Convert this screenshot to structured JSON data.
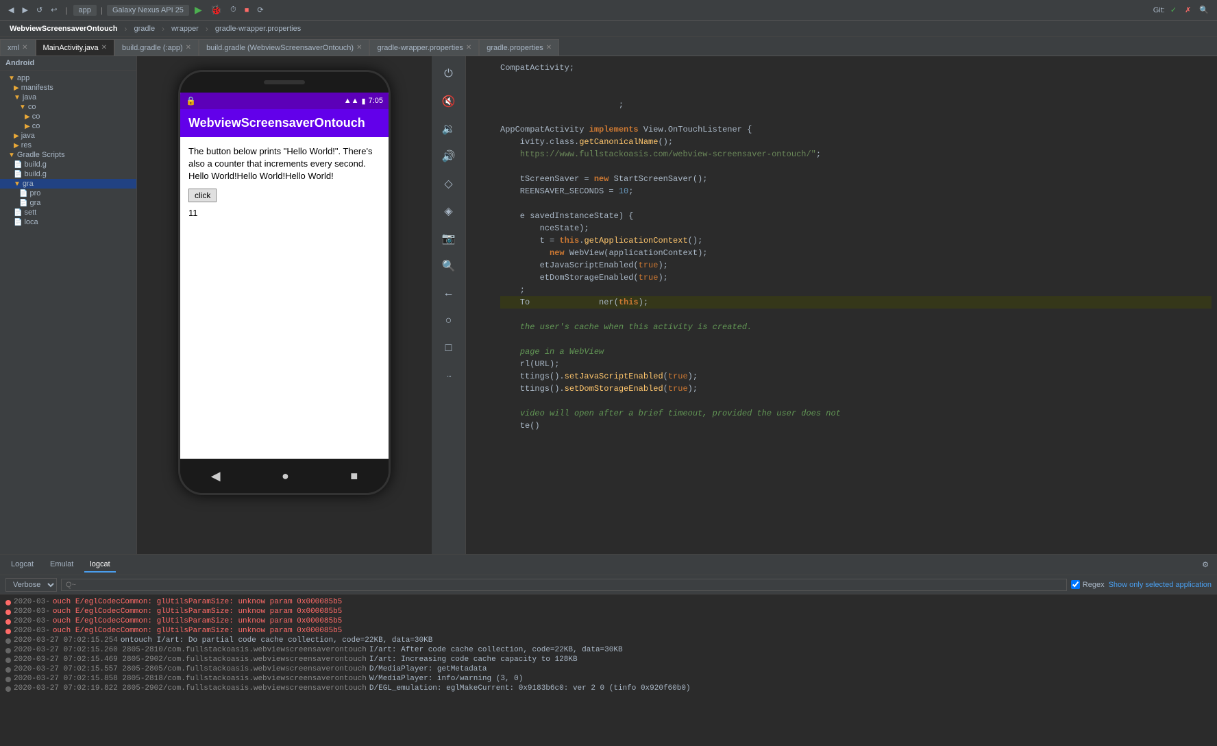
{
  "window": {
    "title": "WebviewScreensaverOntouch"
  },
  "top_toolbar": {
    "device_selector": "Galaxy Nexus API 25",
    "app_module": "app",
    "git_label": "Git:",
    "buttons": [
      "undo",
      "redo",
      "run",
      "debug",
      "profile",
      "stop",
      "sync"
    ]
  },
  "project_breadcrumb": {
    "items": [
      "WebviewScreensaverOntouch",
      "gradle",
      "wrapper",
      "gradle-wrapper.properties"
    ]
  },
  "file_tabs": [
    {
      "label": "xml",
      "active": false
    },
    {
      "label": "MainActivity.java",
      "active": true
    },
    {
      "label": "build.gradle (:app)",
      "active": false
    },
    {
      "label": "build.gradle (WebviewScreensaverOntouch)",
      "active": false
    },
    {
      "label": "gradle-wrapper.properties",
      "active": false
    },
    {
      "label": "gradle.properties",
      "active": false
    }
  ],
  "sidebar": {
    "title": "Android",
    "tree": [
      {
        "level": 0,
        "type": "folder",
        "label": "app",
        "expanded": true
      },
      {
        "level": 1,
        "type": "folder",
        "label": "manifests",
        "expanded": false
      },
      {
        "level": 1,
        "type": "folder",
        "label": "java",
        "expanded": true
      },
      {
        "level": 2,
        "type": "folder",
        "label": "co",
        "expanded": true
      },
      {
        "level": 3,
        "type": "folder",
        "label": "co",
        "expanded": false
      },
      {
        "level": 3,
        "type": "folder",
        "label": "co",
        "expanded": false
      },
      {
        "level": 1,
        "type": "folder",
        "label": "java",
        "expanded": false
      },
      {
        "level": 1,
        "type": "folder",
        "label": "res",
        "expanded": false
      },
      {
        "level": 0,
        "type": "folder",
        "label": "Gradle Scripts",
        "expanded": true
      },
      {
        "level": 1,
        "type": "file",
        "label": "build.g",
        "expanded": false
      },
      {
        "level": 1,
        "type": "file",
        "label": "build.g",
        "expanded": false
      },
      {
        "level": 1,
        "type": "folder",
        "label": "gra",
        "expanded": false,
        "selected": true
      },
      {
        "level": 2,
        "type": "file",
        "label": "pro",
        "expanded": false
      },
      {
        "level": 2,
        "type": "file",
        "label": "gra",
        "expanded": false
      },
      {
        "level": 1,
        "type": "file",
        "label": "sett",
        "expanded": false
      },
      {
        "level": 1,
        "type": "file",
        "label": "loca",
        "expanded": false
      }
    ]
  },
  "phone": {
    "time": "7:05",
    "title": "WebviewScreensaverOntouch",
    "content_text": "The button below prints \"Hello World!\". There's also a counter that increments every second.\nHello World!Hello World!Hello World!",
    "button_label": "click",
    "counter": "11"
  },
  "tool_panel": {
    "icons": [
      "power",
      "speaker-off",
      "speaker-low",
      "speaker-high",
      "diamond",
      "diamond2",
      "camera",
      "search",
      "back",
      "circle",
      "square",
      "more"
    ]
  },
  "code_editor": {
    "lines": [
      {
        "text": "CompatActivity;",
        "highlight": false
      },
      {
        "text": "",
        "highlight": false
      },
      {
        "text": "",
        "highlight": false
      },
      {
        "text": "                      ;",
        "highlight": false
      },
      {
        "text": "",
        "highlight": false
      },
      {
        "text": "AppCompatActivity implements View.OnTouchListener {",
        "highlight": false
      },
      {
        "text": "    ivity.class.getCanonicalName();",
        "highlight": false
      },
      {
        "text": "    https://www.fullstackoasis.com/webview-screensaver-ontouch/\";",
        "highlight": false
      },
      {
        "text": "",
        "highlight": false
      },
      {
        "text": "    tScreenSaver = new StartScreenSaver();",
        "highlight": false
      },
      {
        "text": "    REENSAVER_SECONDS = 10;",
        "highlight": false
      },
      {
        "text": "",
        "highlight": false
      },
      {
        "text": "    e savedInstanceState) {",
        "highlight": false
      },
      {
        "text": "        nceState);",
        "highlight": false
      },
      {
        "text": "        t = this.getApplicationContext();",
        "highlight": false
      },
      {
        "text": "        new WebView(applicationContext);",
        "highlight": false
      },
      {
        "text": "        etJavaScriptEnabled(true);",
        "highlight": false
      },
      {
        "text": "        etDomStorageEnabled(true);",
        "highlight": false
      },
      {
        "text": "    ;",
        "highlight": false
      },
      {
        "text": "    To              ner(this);",
        "highlight": true
      },
      {
        "text": "",
        "highlight": false
      },
      {
        "text": "    the user's cache when this activity is created.",
        "highlight": false
      },
      {
        "text": "",
        "highlight": false
      },
      {
        "text": "    page in a WebView",
        "highlight": false
      },
      {
        "text": "    rl(URL);",
        "highlight": false
      },
      {
        "text": "    ttings().setJavaScriptEnabled(true);",
        "highlight": false
      },
      {
        "text": "    ttings().setDomStorageEnabled(true);",
        "highlight": false
      },
      {
        "text": "",
        "highlight": false
      },
      {
        "text": "    video will open after a brief timeout, provided the user does not",
        "highlight": false
      },
      {
        "text": "    te()",
        "highlight": false
      }
    ]
  },
  "bottom_panel": {
    "tabs": [
      {
        "label": "Logcat",
        "active": false
      },
      {
        "label": "Emulat",
        "active": false
      },
      {
        "label": "logcat",
        "active": true
      }
    ],
    "logcat": {
      "verbose_label": "Verbose",
      "search_placeholder": "Q~",
      "regex_label": "Regex",
      "show_only_label": "Show only selected application",
      "log_lines": [
        {
          "type": "error",
          "timestamp": "2020-03-",
          "text": "ouch E/eglCodecCommon: glUtilsParamSize: unknow param 0x000085b5"
        },
        {
          "type": "error",
          "timestamp": "2020-03-",
          "text": "ouch E/eglCodecCommon: glUtilsParamSize: unknow param 0x000085b5"
        },
        {
          "type": "error",
          "timestamp": "2020-03-",
          "text": "ouch E/eglCodecCommon: glUtilsParamSize: unknow param 0x000085b5"
        },
        {
          "type": "error",
          "timestamp": "2020-03-",
          "text": "ouch E/eglCodecCommon: glUtilsParamSize: unknow param 0x000085b5"
        },
        {
          "type": "info",
          "timestamp": "2020-03-27 07:02:15.254",
          "text": "ontouch I/art: Do partial code cache collection, code=22KB, data=30KB"
        },
        {
          "type": "info",
          "timestamp": "2020-03-27 07:02:15.260 2805-2810/com.fullstackoasis.webviewscreensaverontouch",
          "text": "I/art: After code cache collection, code=22KB, data=30KB"
        },
        {
          "type": "info",
          "timestamp": "2020-03-27 07:02:15.469 2805-2902/com.fullstackoasis.webviewscreensaverontouch",
          "text": "I/art: Increasing code cache capacity to 128KB"
        },
        {
          "type": "debug",
          "timestamp": "2020-03-27 07:02:15.557 2805-2805/com.fullstackoasis.webviewscreensaverontouch",
          "text": "D/MediaPlayer: getMetadata"
        },
        {
          "type": "info",
          "timestamp": "2020-03-27 07:02:15.858 2805-2818/com.fullstackoasis.webviewscreensaverontouch",
          "text": "W/MediaPlayer: info/warning (3, 0)"
        },
        {
          "type": "debug",
          "timestamp": "2020-03-27 07:02:19.822 2805-2902/com.fullstackoasis.webviewscreensaverontouch",
          "text": "D/EGL_emulation: eglMakeCurrent: 0x9183b6c0: ver 2 0 (tinfo 0x920f60b0)"
        }
      ]
    }
  }
}
